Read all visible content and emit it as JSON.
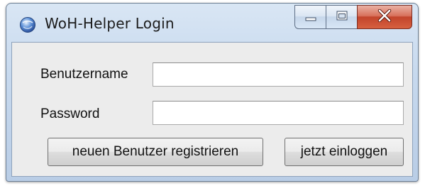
{
  "window": {
    "title": "WoH-Helper Login"
  },
  "icons": {
    "app": "app-globe-icon",
    "minimize": "minimize-icon",
    "maximize": "maximize-icon",
    "close": "close-icon"
  },
  "form": {
    "username_label": "Benutzername",
    "username_value": "",
    "password_label": "Password",
    "password_value": ""
  },
  "buttons": {
    "register": "neuen Benutzer registrieren",
    "login": "jetzt einloggen"
  },
  "colors": {
    "titlebar": "#c7d9ee",
    "close_button": "#c2442b",
    "client_background": "#ececec"
  }
}
